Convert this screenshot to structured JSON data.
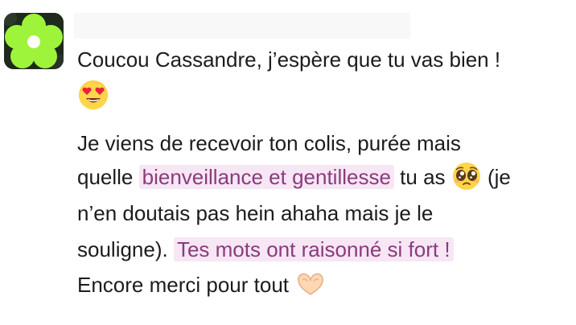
{
  "message": {
    "line1": "Coucou Cassandre, j’espère que tu vas bien !",
    "para2": {
      "l1": "Je viens de recevoir ton colis, purée mais",
      "l2_before": "quelle ",
      "l2_highlight": "bienveillance et gentillesse",
      "l2_after": " tu as ",
      "l2_end": " (je",
      "l3": "n’en doutais pas hein ahaha mais je le",
      "l4_before": "souligne). ",
      "l4_highlight": "Tes mots ont raisonné si fort !",
      "l5": "Encore merci pour tout "
    }
  },
  "emoji": {
    "line1": "heart-eyes-emoji",
    "inline": "pleading-face-emoji",
    "end": "heart-hands-emoji"
  },
  "colors": {
    "highlight_bg": "#f7e6f4",
    "highlight_text": "#8a3b7e",
    "avatar_flower": "#9ef43a"
  }
}
